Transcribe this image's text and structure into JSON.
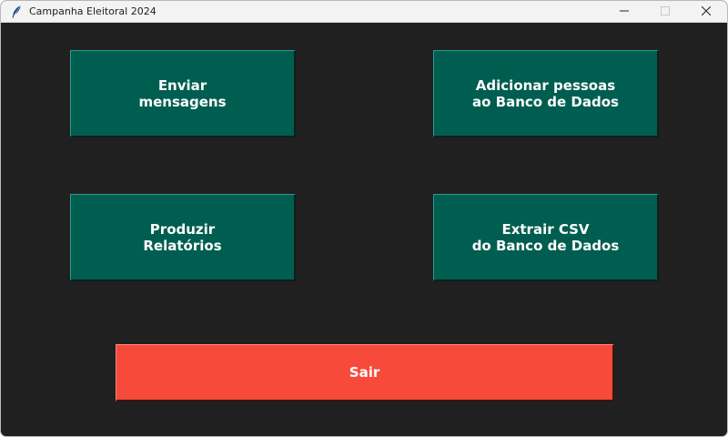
{
  "window": {
    "title": "Campanha Eleitoral 2024",
    "icon": "feather-icon",
    "controls": {
      "minimize_icon": "minimize-icon",
      "maximize_icon": "maximize-icon",
      "close_icon": "close-icon"
    }
  },
  "menu": {
    "send_messages": "Enviar\nmensagens",
    "add_people": "Adicionar pessoas\nao Banco de Dados",
    "produce_reports": "Produzir\nRelatórios",
    "export_csv": "Extrair CSV\ndo Banco de Dados",
    "exit": "Sair"
  },
  "colors": {
    "background": "#202020",
    "tile": "#005e50",
    "exit": "#f74a3a",
    "text": "#ffffff"
  }
}
